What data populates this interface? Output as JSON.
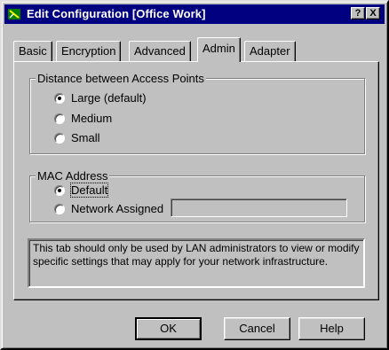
{
  "window": {
    "title": "Edit Configuration [Office Work]",
    "help_label": "?",
    "close_label": "X",
    "icon": "network-connection-icon"
  },
  "tabs": [
    {
      "label": "Basic"
    },
    {
      "label": "Encryption"
    },
    {
      "label": "Advanced"
    },
    {
      "label": "Admin",
      "active": true
    },
    {
      "label": "Adapter"
    }
  ],
  "distance_group": {
    "label": "Distance between Access Points",
    "options": [
      {
        "label": "Large (default)",
        "checked": true
      },
      {
        "label": "Medium",
        "checked": false
      },
      {
        "label": "Small",
        "checked": false
      }
    ]
  },
  "mac_group": {
    "label": "MAC Address",
    "options": [
      {
        "label": "Default",
        "checked": true
      },
      {
        "label": "Network Assigned",
        "checked": false
      }
    ],
    "network_assigned_value": ""
  },
  "info_text": "This tab should only be used by LAN administrators to view or modify specific settings that may apply for your network infrastructure.",
  "buttons": {
    "ok": "OK",
    "cancel": "Cancel",
    "help": "Help"
  },
  "colors": {
    "titlebar": "#000080",
    "face": "#c0c0c0"
  }
}
